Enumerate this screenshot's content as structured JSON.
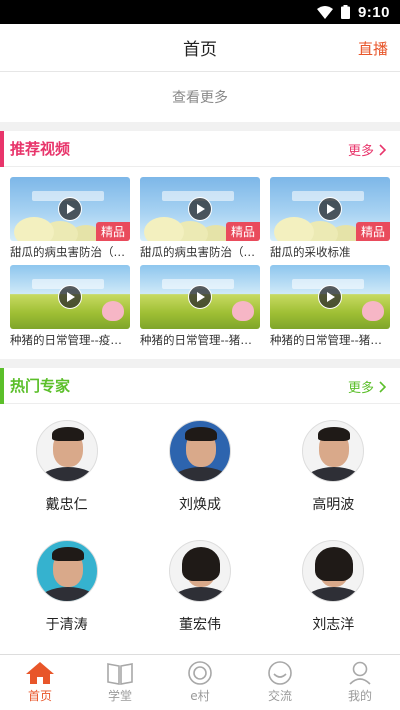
{
  "statusbar": {
    "time": "9:10"
  },
  "header": {
    "title": "首页",
    "right_label": "直播"
  },
  "see_more": "查看更多",
  "videos_section": {
    "title": "推荐视频",
    "more_label": "更多",
    "accent": "#e8356b",
    "items": [
      {
        "title": "甜瓜的病虫害防治（下）",
        "badge": "精品",
        "thumb": "melon"
      },
      {
        "title": "甜瓜的病虫害防治（上）",
        "badge": "精品",
        "thumb": "melon"
      },
      {
        "title": "甜瓜的采收标准",
        "badge": "精品",
        "thumb": "melon"
      },
      {
        "title": "种猪的日常管理--疫病防治",
        "badge": "",
        "thumb": "pig"
      },
      {
        "title": "种猪的日常管理--猪舍与...",
        "badge": "",
        "thumb": "pig"
      },
      {
        "title": "种猪的日常管理--猪舍与...",
        "badge": "",
        "thumb": "pig"
      }
    ]
  },
  "experts_section": {
    "title": "热门专家",
    "more_label": "更多",
    "accent": "#5bbf2a",
    "items": [
      {
        "name": "戴忠仁"
      },
      {
        "name": "刘焕成"
      },
      {
        "name": "高明波"
      },
      {
        "name": "于清涛"
      },
      {
        "name": "董宏伟"
      },
      {
        "name": "刘志洋"
      }
    ]
  },
  "tabbar": {
    "items": [
      {
        "label": "首页",
        "icon": "home-icon",
        "active": true
      },
      {
        "label": "学堂",
        "icon": "book-icon",
        "active": false
      },
      {
        "label": "e村",
        "icon": "circle-icon",
        "active": false
      },
      {
        "label": "交流",
        "icon": "chat-icon",
        "active": false
      },
      {
        "label": "我的",
        "icon": "person-icon",
        "active": false
      }
    ],
    "active_color": "#e8562a"
  }
}
